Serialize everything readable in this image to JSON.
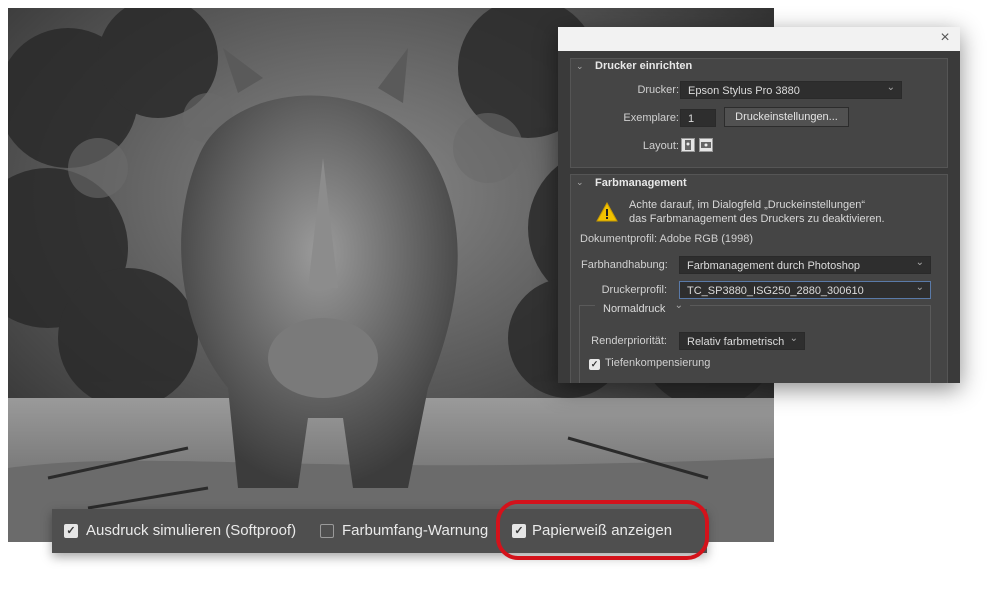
{
  "dialog": {
    "close_glyph": "×",
    "printer_section": {
      "title": "Drucker einrichten",
      "printer_label": "Drucker:",
      "printer_value": "Epson Stylus Pro 3880",
      "copies_label": "Exemplare:",
      "copies_value": "1",
      "print_settings_button": "Druckeinstellungen...",
      "layout_label": "Layout:",
      "layout_icons": [
        "portrait-layout-icon",
        "landscape-layout-icon"
      ]
    },
    "color_section": {
      "title": "Farbmanagement",
      "warning_icon": "warning-triangle-icon",
      "warning_line1": "Achte darauf, im Dialogfeld „Druckeinstellungen“",
      "warning_line2": "das Farbmanagement des Druckers zu deaktivieren.",
      "document_profile": "Dokumentprofil: Adobe RGB (1998)",
      "color_handling_label": "Farbhandhabung:",
      "color_handling_value": "Farbmanagement durch Photoshop",
      "printer_profile_label": "Druckerprofil:",
      "printer_profile_value": "TC_SP3880_ISG250_2880_300610",
      "print_mode_value": "Normaldruck",
      "render_intent_label": "Renderpriorität:",
      "render_intent_value": "Relativ farbmetrisch",
      "black_point_label": "Tiefenkompensierung",
      "black_point_checked": true
    }
  },
  "bottom_bar": {
    "simulate": {
      "label": "Ausdruck simulieren (Softproof)",
      "checked": true
    },
    "gamut_warning": {
      "label": "Farbumfang-Warnung",
      "checked": false
    },
    "paper_white": {
      "label": "Papierweiß anzeigen",
      "checked": true
    }
  },
  "colors": {
    "highlight": "#d4121b",
    "dialog_bg": "#3a3a3a",
    "bar_bg": "#4f4f4f"
  }
}
